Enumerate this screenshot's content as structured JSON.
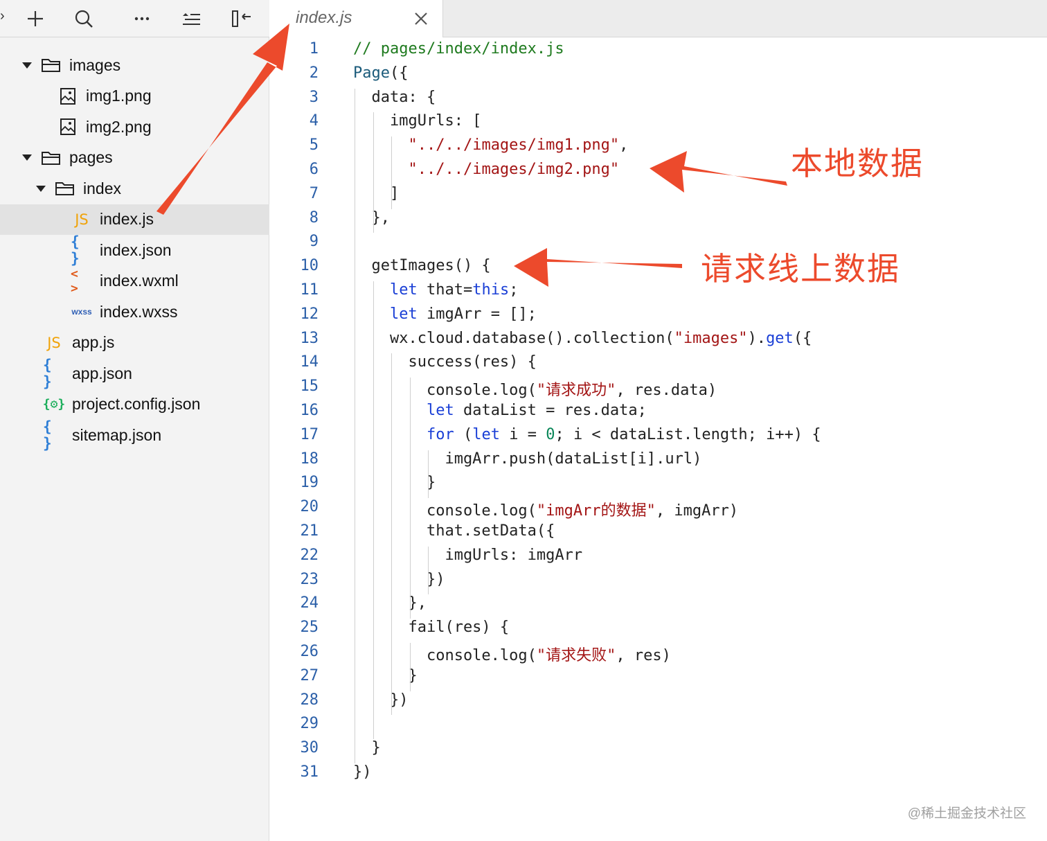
{
  "toolbar": {
    "edge_glyph": "›",
    "buttons": [
      {
        "name": "add-button",
        "icon": "plus-icon"
      },
      {
        "name": "search-button",
        "icon": "search-icon"
      },
      {
        "name": "more-button",
        "icon": "ellipsis-icon"
      },
      {
        "name": "outline-button",
        "icon": "outline-icon"
      },
      {
        "name": "collapse-button",
        "icon": "collapse-panel-icon"
      }
    ]
  },
  "tree": [
    {
      "label": "images",
      "type": "folder",
      "level": 0,
      "expanded": true
    },
    {
      "label": "img1.png",
      "type": "image",
      "level": 1
    },
    {
      "label": "img2.png",
      "type": "image",
      "level": 1
    },
    {
      "label": "pages",
      "type": "folder",
      "level": 0,
      "expanded": true
    },
    {
      "label": "index",
      "type": "folder",
      "level": 1,
      "expanded": true
    },
    {
      "label": "index.js",
      "type": "js",
      "level": 2,
      "selected": true
    },
    {
      "label": "index.json",
      "type": "json",
      "level": 2
    },
    {
      "label": "index.wxml",
      "type": "wxml",
      "level": 2
    },
    {
      "label": "index.wxss",
      "type": "wxss",
      "level": 2
    },
    {
      "label": "app.js",
      "type": "js",
      "level": 0
    },
    {
      "label": "app.json",
      "type": "json",
      "level": 0
    },
    {
      "label": "project.config.json",
      "type": "config",
      "level": 0
    },
    {
      "label": "sitemap.json",
      "type": "json",
      "level": 0
    }
  ],
  "icon_text": {
    "js": "JS",
    "json": "{ }",
    "wxml": "< >",
    "wxss": "wxss",
    "config": "{⚙}"
  },
  "tab": {
    "title": "index.js",
    "close_icon": "close-icon"
  },
  "editor": {
    "lines": [
      [
        [
          "cm",
          "// pages/index/index.js"
        ]
      ],
      [
        [
          "fn",
          "Page"
        ],
        [
          "p",
          "({"
        ]
      ],
      [
        [
          "p",
          "  data: {"
        ]
      ],
      [
        [
          "p",
          "    imgUrls: ["
        ]
      ],
      [
        [
          "p",
          "      "
        ],
        [
          "st",
          "\"../../images/img1.png\""
        ],
        [
          "p",
          ","
        ]
      ],
      [
        [
          "p",
          "      "
        ],
        [
          "st",
          "\"../../images/img2.png\""
        ]
      ],
      [
        [
          "p",
          "    ]"
        ]
      ],
      [
        [
          "p",
          "  },"
        ]
      ],
      [],
      [
        [
          "p",
          "  getImages() {"
        ]
      ],
      [
        [
          "p",
          "    "
        ],
        [
          "kw",
          "let"
        ],
        [
          "p",
          " that="
        ],
        [
          "kw",
          "this"
        ],
        [
          "p",
          ";"
        ]
      ],
      [
        [
          "p",
          "    "
        ],
        [
          "kw",
          "let"
        ],
        [
          "p",
          " imgArr = [];"
        ]
      ],
      [
        [
          "p",
          "    wx.cloud.database().collection("
        ],
        [
          "st",
          "\"images\""
        ],
        [
          "p",
          ")."
        ],
        [
          "kw",
          "get"
        ],
        [
          "p",
          "({"
        ]
      ],
      [
        [
          "p",
          "      success(res) {"
        ]
      ],
      [
        [
          "p",
          "        console.log("
        ],
        [
          "st",
          "\"请求成功\""
        ],
        [
          "p",
          ", res.data)"
        ]
      ],
      [
        [
          "p",
          "        "
        ],
        [
          "kw",
          "let"
        ],
        [
          "p",
          " dataList = res.data;"
        ]
      ],
      [
        [
          "p",
          "        "
        ],
        [
          "kw",
          "for"
        ],
        [
          "p",
          " ("
        ],
        [
          "kw",
          "let"
        ],
        [
          "p",
          " i = "
        ],
        [
          "nm",
          "0"
        ],
        [
          "p",
          "; i < dataList.length; i++) {"
        ]
      ],
      [
        [
          "p",
          "          imgArr.push(dataList[i].url)"
        ]
      ],
      [
        [
          "p",
          "        }"
        ]
      ],
      [
        [
          "p",
          "        console.log("
        ],
        [
          "st",
          "\"imgArr的数据\""
        ],
        [
          "p",
          ", imgArr)"
        ]
      ],
      [
        [
          "p",
          "        that.setData({"
        ]
      ],
      [
        [
          "p",
          "          imgUrls: imgArr"
        ]
      ],
      [
        [
          "p",
          "        })"
        ]
      ],
      [
        [
          "p",
          "      },"
        ]
      ],
      [
        [
          "p",
          "      fail(res) {"
        ]
      ],
      [
        [
          "p",
          "        console.log("
        ],
        [
          "st",
          "\"请求失败\""
        ],
        [
          "p",
          ", res)"
        ]
      ],
      [
        [
          "p",
          "      }"
        ]
      ],
      [
        [
          "p",
          "    })"
        ]
      ],
      [],
      [
        [
          "p",
          "  }"
        ]
      ],
      [
        [
          "p",
          "})"
        ]
      ]
    ]
  },
  "annotations": {
    "local_data": "本地数据",
    "online_data": "请求线上数据",
    "arrow_color": "#ec4a2c"
  },
  "watermark": "@稀土掘金技术社区"
}
